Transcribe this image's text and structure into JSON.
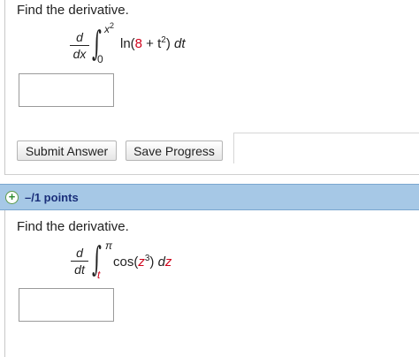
{
  "question1": {
    "prompt": "Find the derivative.",
    "frac_num": "d",
    "frac_den": "dx",
    "upper_limit_base": "x",
    "upper_limit_exp": "2",
    "lower_limit": "0",
    "integrand_pre": "ln(",
    "integrand_const": "8",
    "integrand_mid": " + t",
    "integrand_exp": "2",
    "integrand_post": ") ",
    "integrand_diff": "dt",
    "answer_value": ""
  },
  "buttons": {
    "submit_label": "Submit Answer",
    "save_label": "Save Progress"
  },
  "points_bar": {
    "expand_symbol": "+",
    "label": "–/1 points"
  },
  "question2": {
    "prompt": "Find the derivative.",
    "frac_num": "d",
    "frac_den": "dt",
    "upper_limit": "π",
    "lower_limit": "t",
    "integrand_pre": "cos(",
    "integrand_var": "z",
    "integrand_exp": "3",
    "integrand_post": ") ",
    "integrand_d": "d",
    "integrand_diffvar": "z",
    "answer_value": ""
  },
  "colors": {
    "points_bar": "#a6c8e6",
    "points_text": "#1a2f7a",
    "highlight_red": "#d0021b"
  }
}
